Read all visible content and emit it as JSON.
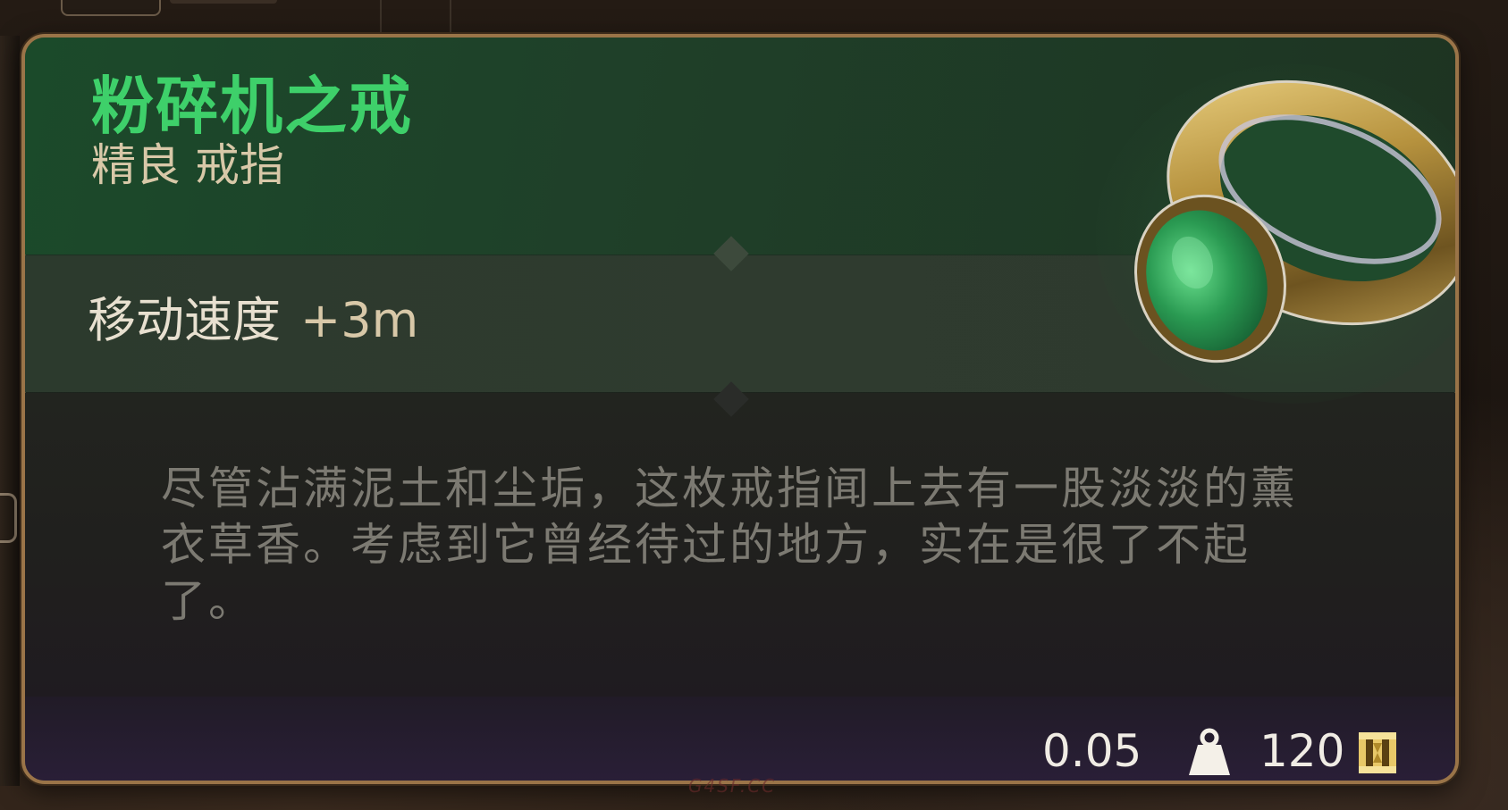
{
  "item": {
    "name": "粉碎机之戒",
    "rarity_type": "精良 戒指",
    "stat_label": "移动速度",
    "stat_value": "+3m",
    "description": "尽管沾满泥土和尘垢，这枚戒指闻上去有一股淡淡的薰衣草香。考虑到它曾经待过的地方，实在是很了不起了。",
    "weight": "0.05",
    "price": "120",
    "weight_icon": "weight-icon",
    "currency_icon": "gold-coin-icon",
    "image": "jade-ring"
  },
  "colors": {
    "name": "#3ed06a",
    "border": "#9a7448",
    "subtitle": "#d8c8a8",
    "description": "#7c7a72",
    "currency": "#e8c868"
  }
}
